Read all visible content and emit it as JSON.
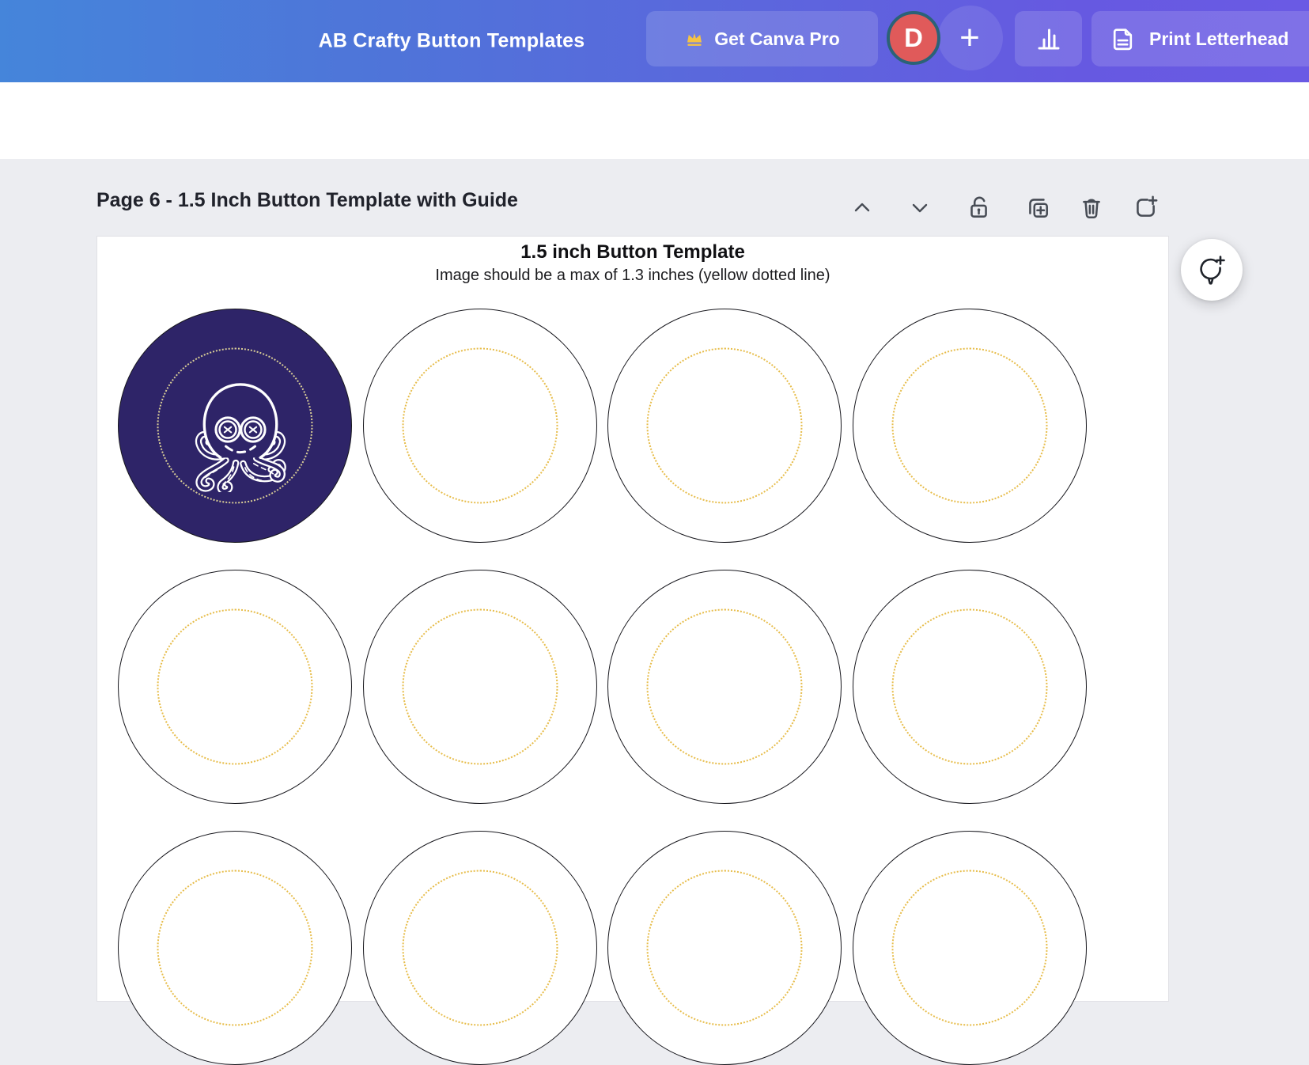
{
  "topbar": {
    "document_title": "AB Crafty Button Templates",
    "get_canva_pro": {
      "label": "Get Canva Pro",
      "icon": "crown-icon",
      "crown_color": "#f5c344"
    },
    "avatar": {
      "initial": "D",
      "color": "#e05a5a",
      "ring_color": "#2b6277"
    },
    "add_button_glyph": "+",
    "chart_button": {
      "icon": "bar-chart-icon"
    },
    "print_button": {
      "label": "Print Letterhead",
      "icon": "document-icon"
    },
    "colors": {
      "gradient_left": "#4585da",
      "gradient_right": "#6a5ae4",
      "button_background": "rgba(255,255,255,0.14)"
    }
  },
  "page_header": {
    "title": "Page 6 - 1.5 Inch Button Template with Guide",
    "actions": [
      {
        "name": "move-page-up",
        "icon": "chevron-up-icon"
      },
      {
        "name": "move-page-down",
        "icon": "chevron-down-icon"
      },
      {
        "name": "lock-page",
        "icon": "unlocked-padlock-icon"
      },
      {
        "name": "duplicate-page",
        "icon": "duplicate-plus-icon"
      },
      {
        "name": "delete-page",
        "icon": "trash-icon"
      },
      {
        "name": "add-page",
        "icon": "add-page-icon"
      }
    ]
  },
  "canvas_page": {
    "title": "1.5 inch Button Template",
    "subtitle": "Image should be a max of 1.3 inches (yellow dotted line)",
    "grid": {
      "columns": 4,
      "rows": 3,
      "cells": [
        {
          "filled": true,
          "artwork": "plush-octopus"
        },
        {
          "filled": false
        },
        {
          "filled": false
        },
        {
          "filled": false
        },
        {
          "filled": false
        },
        {
          "filled": false
        },
        {
          "filled": false
        },
        {
          "filled": false
        },
        {
          "filled": false
        },
        {
          "filled": false
        },
        {
          "filled": false
        },
        {
          "filled": false
        }
      ]
    },
    "colors": {
      "button_background": "#2e2468",
      "circle_outline": "#17171d",
      "guide_dotted_yellow": "#e7bd4b",
      "guide_dotted_on_dark": "#d9cd96"
    }
  },
  "floating": {
    "add_comment_button": {
      "icon": "comment-plus-icon"
    }
  },
  "window": {
    "background": "#ecedf1",
    "toolbar_strip": "#ffffff"
  }
}
